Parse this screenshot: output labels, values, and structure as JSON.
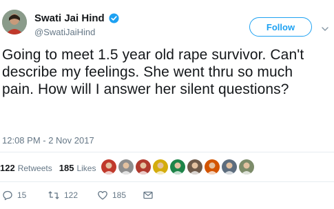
{
  "user": {
    "display_name": "Swati Jai Hind",
    "handle": "@SwatiJaiHind",
    "verified": true,
    "avatar_icon": "profile-photo"
  },
  "follow_label": "Follow",
  "tweet": {
    "text": "Going to meet 1.5 year old rape survivor. Can't describe my feelings. She went thru so much pain. How will I answer her silent questions?",
    "timestamp": "12:08 PM - 2 Nov 2017"
  },
  "stats": {
    "retweets_count": "122",
    "retweets_label": "Retweets",
    "likes_count": "185",
    "likes_label": "Likes"
  },
  "liker_avatars": [
    {
      "icon": "liker-avatar-1",
      "color": "#c0392b"
    },
    {
      "icon": "liker-avatar-2",
      "color": "#8e8e8e"
    },
    {
      "icon": "liker-avatar-3",
      "color": "#b03a2e"
    },
    {
      "icon": "liker-avatar-4",
      "color": "#d4ac0d"
    },
    {
      "icon": "liker-avatar-5",
      "color": "#1e8449"
    },
    {
      "icon": "liker-avatar-6",
      "color": "#6e5a4a"
    },
    {
      "icon": "liker-avatar-7",
      "color": "#d35400"
    },
    {
      "icon": "liker-avatar-8",
      "color": "#5d6d7e"
    },
    {
      "icon": "liker-avatar-9",
      "color": "#7d8c6a"
    }
  ],
  "actions": {
    "reply_count": "15",
    "retweet_count": "122",
    "like_count": "185"
  },
  "colors": {
    "accent": "#1da1f2",
    "text": "#14171a",
    "muted": "#657786"
  }
}
